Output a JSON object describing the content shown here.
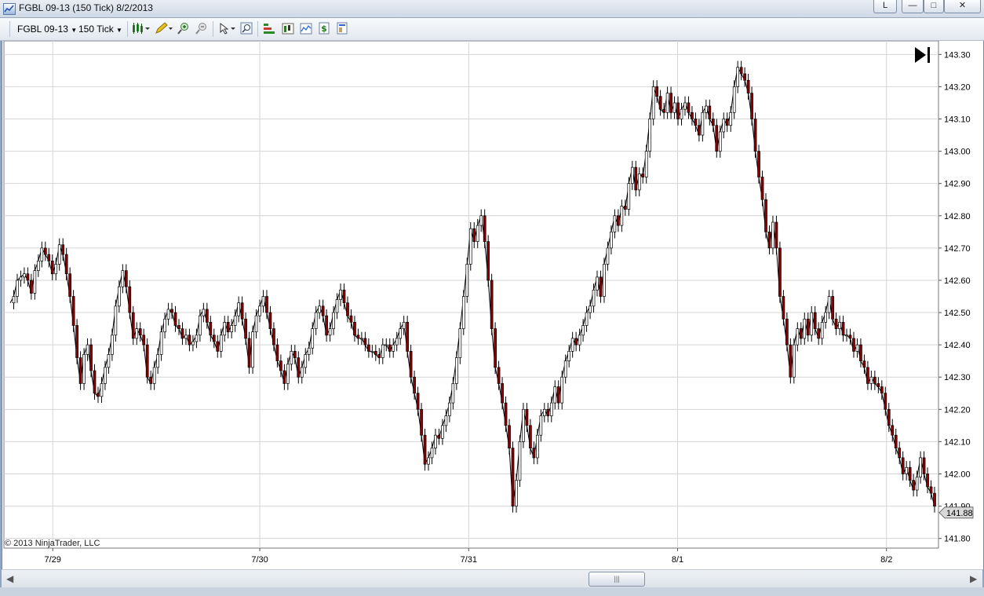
{
  "window": {
    "title": "FGBL 09-13 (150 Tick)  8/2/2013",
    "buttons": {
      "link": "L",
      "minimize": "—",
      "maximize": "□",
      "close": "✕"
    }
  },
  "toolbar": {
    "instrument": "FGBL 09-13",
    "interval": "150 Tick",
    "icons": [
      "candlestick-icon",
      "pencil-icon",
      "zoom-in-icon",
      "zoom-out-icon",
      "pointer-icon",
      "magnifier-icon",
      "bars-icon",
      "data-box-icon",
      "indicator-icon",
      "strategy-icon",
      "properties-icon"
    ]
  },
  "chart": {
    "copyright": "© 2013 NinjaTrader, LLC",
    "go_to_end_icon": "skip-to-end-icon"
  },
  "chart_data": {
    "type": "line",
    "title": "",
    "xlabel": "",
    "ylabel": "",
    "x_ticks": [
      "7/29",
      "7/30",
      "7/31",
      "8/1",
      "8/2"
    ],
    "y_ticks": [
      "141.80",
      "141.90",
      "142.00",
      "142.10",
      "142.20",
      "142.30",
      "142.40",
      "142.50",
      "142.60",
      "142.70",
      "142.80",
      "142.90",
      "143.00",
      "143.10",
      "143.20",
      "143.30"
    ],
    "ylim": [
      141.77,
      143.33
    ],
    "grid": true,
    "last_price_label": "141.88",
    "colors": {
      "up": "#ffffff",
      "down": "#8b0000",
      "wick": "#000000",
      "grid": "#d4d4d4"
    },
    "series": [
      {
        "values": [
          142.53,
          142.55,
          142.6,
          142.61,
          142.62,
          142.6,
          142.56,
          142.63,
          142.66,
          142.7,
          142.68,
          142.66,
          142.62,
          142.65,
          142.71,
          142.68,
          142.62,
          142.55,
          142.46,
          142.36,
          142.28,
          142.37,
          142.4,
          142.32,
          142.25,
          142.24,
          142.28,
          142.33,
          142.37,
          142.43,
          142.52,
          142.58,
          142.63,
          142.58,
          142.5,
          142.42,
          142.45,
          142.43,
          142.4,
          142.3,
          142.28,
          142.33,
          142.37,
          142.44,
          142.48,
          142.51,
          142.5,
          142.46,
          142.45,
          142.42,
          142.43,
          142.4,
          142.41,
          142.43,
          142.49,
          142.51,
          142.47,
          142.43,
          142.41,
          142.38,
          142.43,
          142.47,
          142.44,
          142.46,
          142.49,
          142.53,
          142.48,
          142.42,
          142.33,
          142.44,
          142.49,
          142.52,
          142.55,
          142.5,
          142.45,
          142.4,
          142.35,
          142.32,
          142.28,
          142.34,
          142.38,
          142.36,
          142.3,
          142.33,
          142.37,
          142.39,
          142.45,
          142.5,
          142.52,
          142.49,
          142.43,
          142.45,
          142.5,
          142.54,
          142.57,
          142.53,
          142.49,
          142.47,
          142.43,
          142.42,
          142.42,
          142.4,
          142.38,
          142.38,
          142.37,
          142.36,
          142.4,
          142.4,
          142.38,
          142.4,
          142.42,
          142.45,
          142.47,
          142.38,
          142.3,
          142.25,
          142.2,
          142.12,
          142.03,
          142.05,
          142.08,
          142.12,
          142.11,
          142.15,
          142.18,
          142.22,
          142.28,
          142.36,
          142.45,
          142.55,
          142.65,
          142.76,
          142.72,
          142.77,
          142.8,
          142.72,
          142.6,
          142.45,
          142.33,
          142.28,
          142.22,
          142.15,
          142.08,
          141.9,
          141.98,
          142.1,
          142.2,
          142.15,
          142.08,
          142.05,
          142.12,
          142.18,
          142.2,
          142.18,
          142.22,
          142.27,
          142.22,
          142.3,
          142.35,
          142.38,
          142.42,
          142.4,
          142.43,
          142.46,
          142.5,
          142.52,
          142.57,
          142.61,
          142.55,
          142.65,
          142.7,
          142.75,
          142.8,
          142.77,
          142.83,
          142.82,
          142.9,
          142.95,
          142.88,
          142.93,
          142.92,
          143.0,
          143.1,
          143.2,
          143.17,
          143.13,
          143.12,
          143.18,
          143.12,
          143.15,
          143.1,
          143.13,
          143.15,
          143.12,
          143.1,
          143.08,
          143.05,
          143.12,
          143.14,
          143.1,
          143.08,
          143.0,
          143.06,
          143.1,
          143.08,
          143.12,
          143.2,
          143.26,
          143.24,
          143.22,
          143.18,
          143.1,
          143.0,
          142.92,
          142.85,
          142.75,
          142.7,
          142.78,
          142.7,
          142.55,
          142.48,
          142.4,
          142.3,
          142.4,
          142.45,
          142.42,
          142.48,
          142.43,
          142.5,
          142.45,
          142.42,
          142.47,
          142.5,
          142.55,
          142.48,
          142.45,
          142.47,
          142.43,
          142.43,
          142.42,
          142.38,
          142.4,
          142.35,
          142.33,
          142.28,
          142.3,
          142.28,
          142.27,
          142.25,
          142.2,
          142.15,
          142.12,
          142.08,
          142.05,
          142.0,
          142.02,
          141.98,
          141.95,
          141.99,
          142.05,
          142.0,
          141.96,
          141.94,
          141.9
        ]
      }
    ]
  }
}
